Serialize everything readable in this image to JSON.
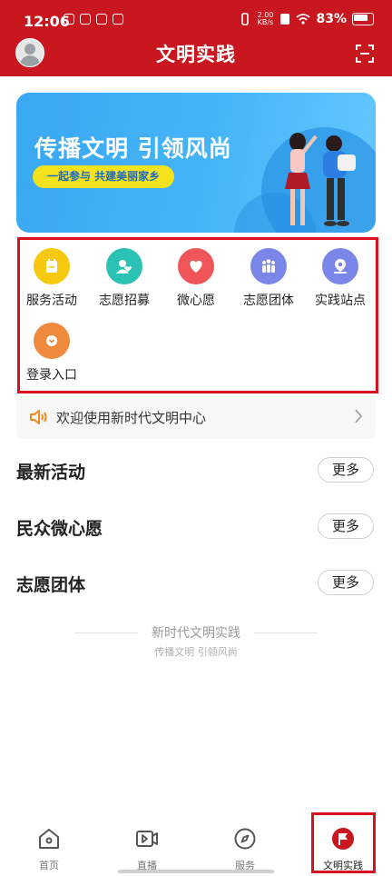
{
  "status_bar": {
    "time": "12:06",
    "net_speed": "2.00",
    "net_unit": "KB/s",
    "battery": "83%"
  },
  "header": {
    "title": "文明实践",
    "avatar_icon": "user-avatar",
    "scan_icon": "scan-icon"
  },
  "banner": {
    "title": "传播文明 引领风尚",
    "slogan": "一起参与 共建美丽家乡"
  },
  "menu": [
    {
      "label": "服务活动",
      "icon": "calendar-icon",
      "color": "#f6c90e"
    },
    {
      "label": "志愿招募",
      "icon": "user-heart-icon",
      "color": "#2bc2b5"
    },
    {
      "label": "微心愿",
      "icon": "heart-icon",
      "color": "#f0555a"
    },
    {
      "label": "志愿团体",
      "icon": "group-icon",
      "color": "#7a86e8"
    },
    {
      "label": "实践站点",
      "icon": "location-icon",
      "color": "#7a86e8"
    },
    {
      "label": "登录入口",
      "icon": "login-icon",
      "color": "#f08a3c"
    }
  ],
  "notice": {
    "text": "欢迎使用新时代文明中心"
  },
  "sections": [
    {
      "title": "最新活动",
      "more": "更多"
    },
    {
      "title": "民众微心愿",
      "more": "更多"
    },
    {
      "title": "志愿团体",
      "more": "更多"
    }
  ],
  "footer": {
    "title": "新时代文明实践",
    "subtitle": "传播文明 引领风尚"
  },
  "tabs": [
    {
      "label": "首页",
      "icon": "home-icon"
    },
    {
      "label": "直播",
      "icon": "live-video-icon"
    },
    {
      "label": "服务",
      "icon": "compass-icon"
    },
    {
      "label": "文明实践",
      "icon": "flag-icon"
    }
  ],
  "colors": {
    "brand_red": "#c8171e",
    "highlight_red": "#d8111d"
  }
}
